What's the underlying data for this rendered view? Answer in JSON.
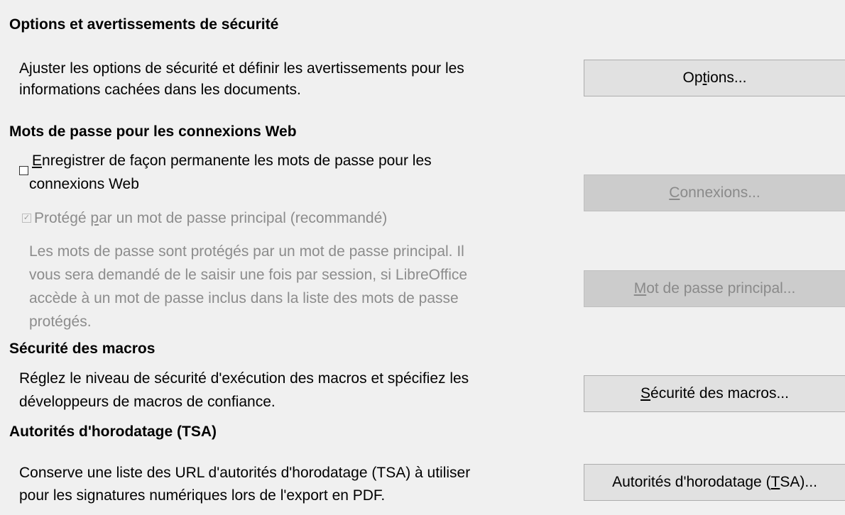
{
  "sections": {
    "security_options": {
      "title": "Options et avertissements de sécurité",
      "desc_line1": "Ajuster les options de sécurité et définir les avertissements pour les",
      "desc_line2": "informations cachées dans les documents.",
      "button": {
        "before": "Op",
        "accel": "t",
        "after": "ions..."
      }
    },
    "web_passwords": {
      "title": "Mots de passe pour les connexions Web",
      "persist_checkbox": {
        "checked": false,
        "line1_accel": "E",
        "line1_rest": "nregistrer de façon permanente les mots de passe pour les",
        "line2": "connexions Web"
      },
      "connections_button": {
        "before": "",
        "accel": "C",
        "after": "onnexions..."
      },
      "master_checkbox": {
        "checked": true,
        "before": "Protégé ",
        "accel": "p",
        "after": "ar un mot de passe principal (recommandé)"
      },
      "master_desc_lines": [
        "Les mots de passe sont protégés par un mot de passe principal. Il",
        "vous sera demandé de le saisir une fois par session, si LibreOffice",
        "accède à un mot de passe inclus dans la liste des mots de passe",
        "protégés."
      ],
      "master_button": {
        "before": "",
        "accel": "M",
        "after": "ot de passe principal..."
      }
    },
    "macro_security": {
      "title": "Sécurité des macros",
      "desc_line1": "Réglez le niveau de sécurité d'exécution des macros et spécifiez les",
      "desc_line2": "développeurs de macros de confiance.",
      "button": {
        "before": "",
        "accel": "S",
        "after": "écurité des macros..."
      }
    },
    "tsa": {
      "title": "Autorités d'horodatage (TSA)",
      "desc_line1": "Conserve une liste des URL d'autorités d'horodatage (TSA) à utiliser",
      "desc_line2": "pour les signatures numériques lors de l'export en PDF.",
      "button": {
        "before": "Autorités d'horodatage (",
        "accel": "T",
        "after": "SA)..."
      }
    }
  }
}
